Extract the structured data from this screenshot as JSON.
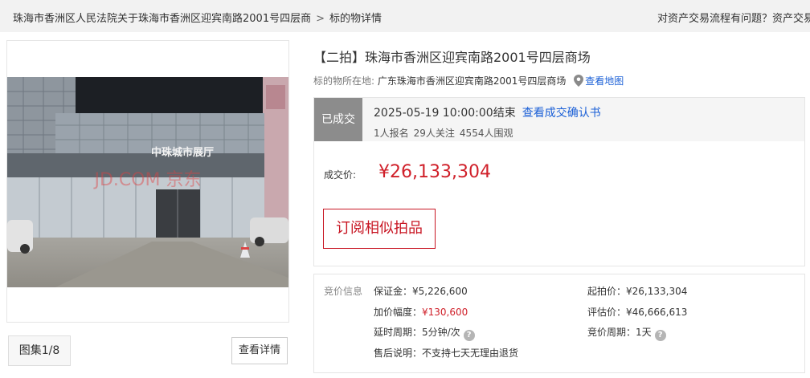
{
  "breadcrumb": {
    "court": "珠海市香洲区人民法院关于珠海市香洲区迎宾南路2001号四层商",
    "separator": ">",
    "current": "标的物详情"
  },
  "help_text": "对资产交易流程有问题？资产交易客",
  "gallery": {
    "sign_text": "中珠城市展厅",
    "watermark": "JD.COM 京东",
    "counter": "图集1/8",
    "detail_button": "查看详情"
  },
  "item": {
    "title": "【二拍】珠海市香洲区迎宾南路2001号四层商场",
    "location_label": "标的物所在地:",
    "location": "广东珠海市香洲区迎宾南路2001号四层商场",
    "map_link": "查看地图"
  },
  "status": {
    "tag": "已成交",
    "end_time": "2025-05-19 10:00:00结束",
    "confirm_link": "查看成交确认书",
    "signups": "1人报名",
    "followers": "29人关注",
    "viewers": "4554人围观",
    "price_label": "成交价:",
    "price": "¥26,133,304",
    "subscribe_button": "订阅相似拍品"
  },
  "bid_info": {
    "header": "竞价信息",
    "deposit": "保证金：¥5,226,600",
    "increment_label": "加价幅度：",
    "increment_value": "¥130,600",
    "delay": "延时周期：5分钟/次",
    "after_sale": "售后说明：不支持七天无理由退货",
    "start_price": "起拍价：¥26,133,304",
    "appraisal": "评估价：¥46,666,613",
    "bid_period": "竞价周期：1天"
  },
  "colors": {
    "accent_red": "#d0202a",
    "link_blue": "#1a5fd6",
    "status_gray": "#8c8c8c"
  }
}
